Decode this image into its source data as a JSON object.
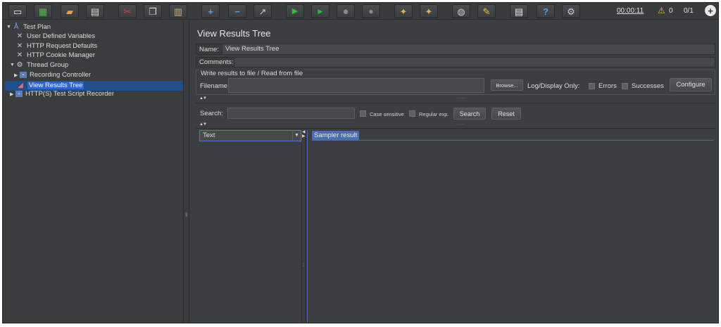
{
  "toolbar": {
    "buttons": [
      {
        "name": "new-icon",
        "glyph": "▭"
      },
      {
        "name": "templates-icon",
        "glyph": "▦"
      },
      {
        "name": "open-icon",
        "glyph": "▰"
      },
      {
        "name": "save-icon",
        "glyph": "▤"
      },
      {
        "name": "cut-icon",
        "glyph": "✂"
      },
      {
        "name": "copy-icon",
        "glyph": "❐"
      },
      {
        "name": "paste-icon",
        "glyph": "▥"
      },
      {
        "name": "expand-icon",
        "glyph": "+"
      },
      {
        "name": "collapse-icon",
        "glyph": "−"
      },
      {
        "name": "toggle-icon",
        "glyph": "↗"
      },
      {
        "name": "start-icon",
        "glyph": "▶"
      },
      {
        "name": "start-no-pauses-icon",
        "glyph": "▶"
      },
      {
        "name": "stop-icon",
        "glyph": "●"
      },
      {
        "name": "shutdown-icon",
        "glyph": "●"
      },
      {
        "name": "clear-icon",
        "glyph": "✦"
      },
      {
        "name": "clear-all-icon",
        "glyph": "✦"
      },
      {
        "name": "search-icon",
        "glyph": "◍"
      },
      {
        "name": "reset-search-icon",
        "glyph": "✎"
      },
      {
        "name": "function-helper-icon",
        "glyph": "▤"
      },
      {
        "name": "help-icon",
        "glyph": "?"
      },
      {
        "name": "remote-icon",
        "glyph": "⚙"
      }
    ],
    "timer": "00:00:11",
    "warning_count": "0",
    "threads": "0/1",
    "globe_glyph": "+"
  },
  "tree": {
    "items": [
      {
        "label": "Test Plan",
        "icon": "test-plan-icon",
        "glyph": "Å",
        "toggle": "▼"
      },
      {
        "label": "User Defined Variables",
        "icon": "config-element-icon",
        "glyph": "✕",
        "toggle": ""
      },
      {
        "label": "HTTP Request Defaults",
        "icon": "config-element-icon",
        "glyph": "✕",
        "toggle": ""
      },
      {
        "label": "HTTP Cookie Manager",
        "icon": "config-element-icon",
        "glyph": "✕",
        "toggle": ""
      },
      {
        "label": "Thread Group",
        "icon": "thread-group-icon",
        "glyph": "⚙",
        "toggle": "▼"
      },
      {
        "label": "Recording Controller",
        "icon": "controller-icon",
        "glyph": "▪",
        "toggle": "▶"
      },
      {
        "label": "View Results Tree",
        "icon": "listener-icon",
        "glyph": "◢",
        "toggle": ""
      },
      {
        "label": "HTTP(S) Test Script Recorder",
        "icon": "recorder-icon",
        "glyph": "▪",
        "toggle": "▶"
      }
    ],
    "selected": "View Results Tree"
  },
  "main": {
    "title": "View Results Tree",
    "name_label": "Name:",
    "name_value": "View Results Tree",
    "comments_label": "Comments:",
    "file_group_legend": "Write results to file / Read from file",
    "filename_label": "Filename",
    "browse_label": "Browse...",
    "log_display_label": "Log/Display Only:",
    "errors_label": "Errors",
    "successes_label": "Successes",
    "configure_label": "Configure",
    "search_label": "Search:",
    "case_sensitive_label": "Case sensitive",
    "regular_exp_label": "Regular exp.",
    "search_button": "Search",
    "reset_button": "Reset",
    "renderer_value": "Text",
    "sampler_tab": "Sampler result"
  }
}
